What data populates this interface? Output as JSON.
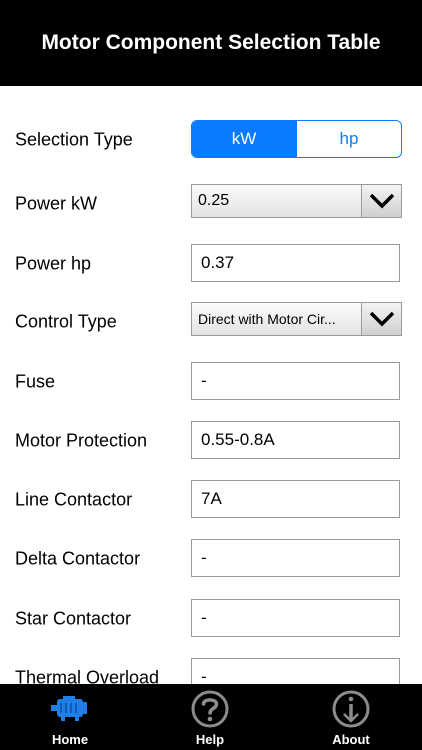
{
  "header": {
    "title": "Motor Component Selection Table"
  },
  "form": {
    "selection_type": {
      "label": "Selection Type",
      "options": [
        "kW",
        "hp"
      ],
      "selected": "kW"
    },
    "power_kw": {
      "label": "Power kW",
      "value": "0.25"
    },
    "power_hp": {
      "label": "Power hp",
      "value": "0.37"
    },
    "control_type": {
      "label": "Control Type",
      "value": "Direct with Motor Cir..."
    },
    "fuse": {
      "label": "Fuse",
      "value": "-"
    },
    "motor_protection": {
      "label": "Motor Protection",
      "value": "0.55-0.8A"
    },
    "line_contactor": {
      "label": "Line Contactor",
      "value": "7A"
    },
    "delta_contactor": {
      "label": "Delta Contactor",
      "value": "-"
    },
    "star_contactor": {
      "label": "Star Contactor",
      "value": "-"
    },
    "thermal_overload": {
      "label": "Thermal Overload",
      "value": "-"
    }
  },
  "tabbar": {
    "items": [
      {
        "label": "Home",
        "icon": "motor-icon",
        "active": true
      },
      {
        "label": "Help",
        "icon": "question-icon",
        "active": false
      },
      {
        "label": "About",
        "icon": "info-icon",
        "active": false
      }
    ]
  },
  "colors": {
    "accent": "#0a7bff",
    "bars": "#000000"
  }
}
